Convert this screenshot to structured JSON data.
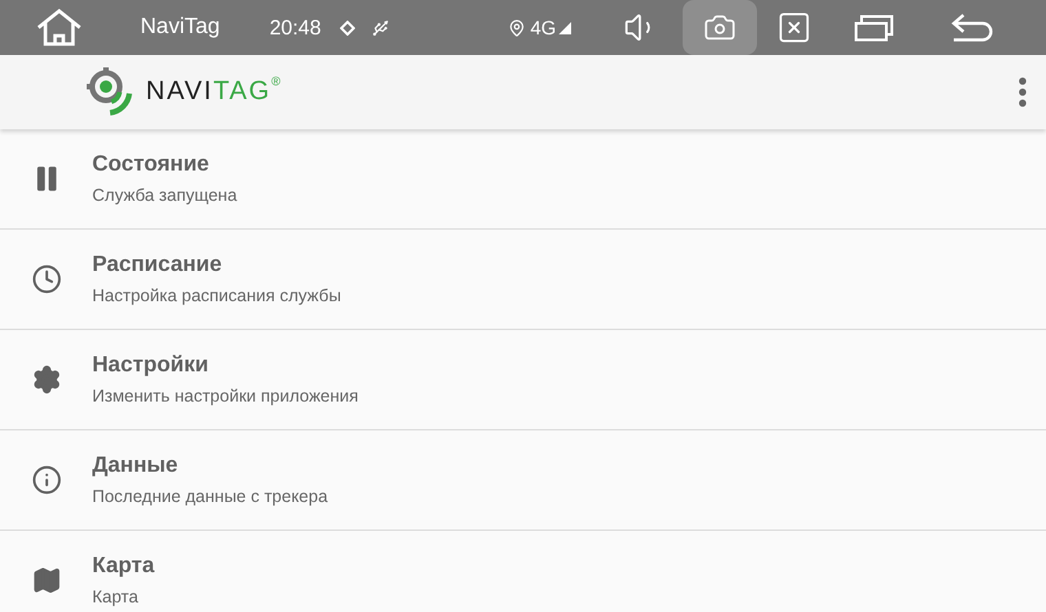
{
  "status_bar": {
    "app_name": "NaviTag",
    "time": "20:48",
    "network": "4G"
  },
  "app_bar": {
    "logo": {
      "part_1": "NAVI",
      "part_2": "TAG",
      "mark": "®"
    }
  },
  "menu": [
    {
      "title": "Состояние",
      "subtitle": "Служба запущена"
    },
    {
      "title": "Расписание",
      "subtitle": "Настройка расписания службы"
    },
    {
      "title": "Настройки",
      "subtitle": "Изменить настройки приложения"
    },
    {
      "title": "Данные",
      "subtitle": "Последние данные с трекера"
    },
    {
      "title": "Карта",
      "subtitle": "Карта"
    }
  ]
}
